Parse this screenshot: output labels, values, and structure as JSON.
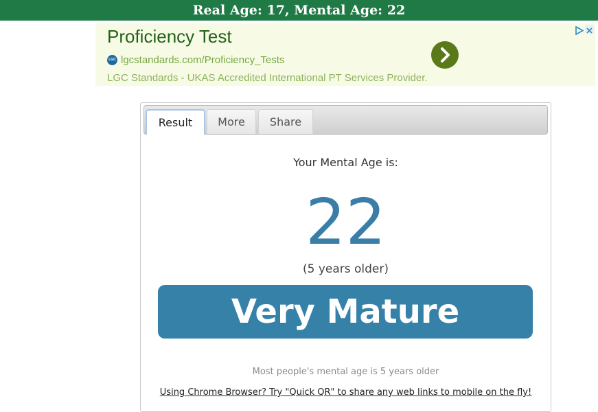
{
  "header": {
    "title": "Real Age: 17, Mental Age: 22"
  },
  "ad": {
    "title": "Proficiency Test",
    "logo_text": "LGC",
    "url": "lgcstandards.com/Proficiency_Tests",
    "description": "LGC Standards - UKAS Accredited International PT Services Provider.",
    "colors": {
      "title": "#226318",
      "url": "#77a843",
      "background": "#f7fbe6",
      "go_button": "#5a7a1a"
    },
    "icons": [
      "chevron-right-icon",
      "adchoices-icon",
      "close-icon"
    ]
  },
  "tabs": [
    {
      "label": "Result",
      "active": true
    },
    {
      "label": "More",
      "active": false
    },
    {
      "label": "Share",
      "active": false
    }
  ],
  "result": {
    "intro": "Your Mental Age is:",
    "mental_age": "22",
    "difference": "(5 years older)",
    "verdict": "Very Mature",
    "stat": "Most people's mental age is 5 years older",
    "promo": "Using Chrome Browser? Try \"Quick QR\" to share any web links to mobile on the fly!",
    "colors": {
      "accent": "#3581a8",
      "header_bar": "#1f7a46"
    }
  }
}
